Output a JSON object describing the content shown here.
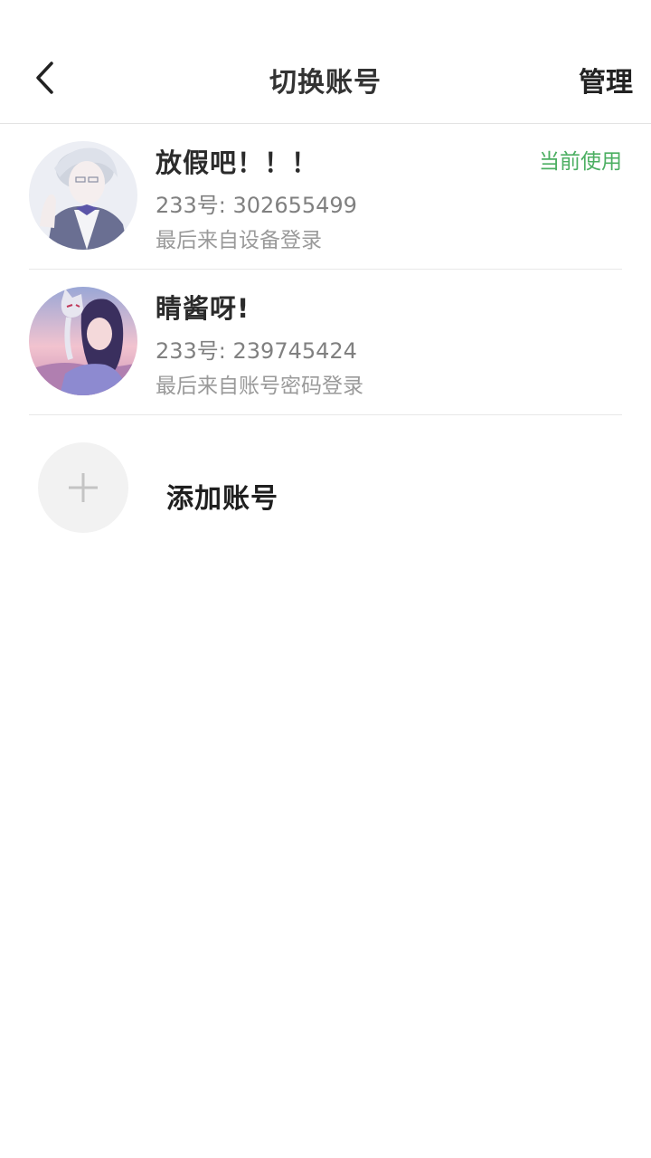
{
  "header": {
    "title": "切换账号",
    "manage_label": "管理"
  },
  "accounts": [
    {
      "name": "放假吧！！！",
      "uid": "233号: 302655499",
      "login_source": "最后来自设备登录",
      "status": "当前使用"
    },
    {
      "name": "睛酱呀!",
      "uid": "233号: 239745424",
      "login_source": "最后来自账号密码登录"
    }
  ],
  "add_account": {
    "label": "添加账号"
  },
  "colors": {
    "accent_green": "#4caf62",
    "divider": "#e8e8e8"
  }
}
